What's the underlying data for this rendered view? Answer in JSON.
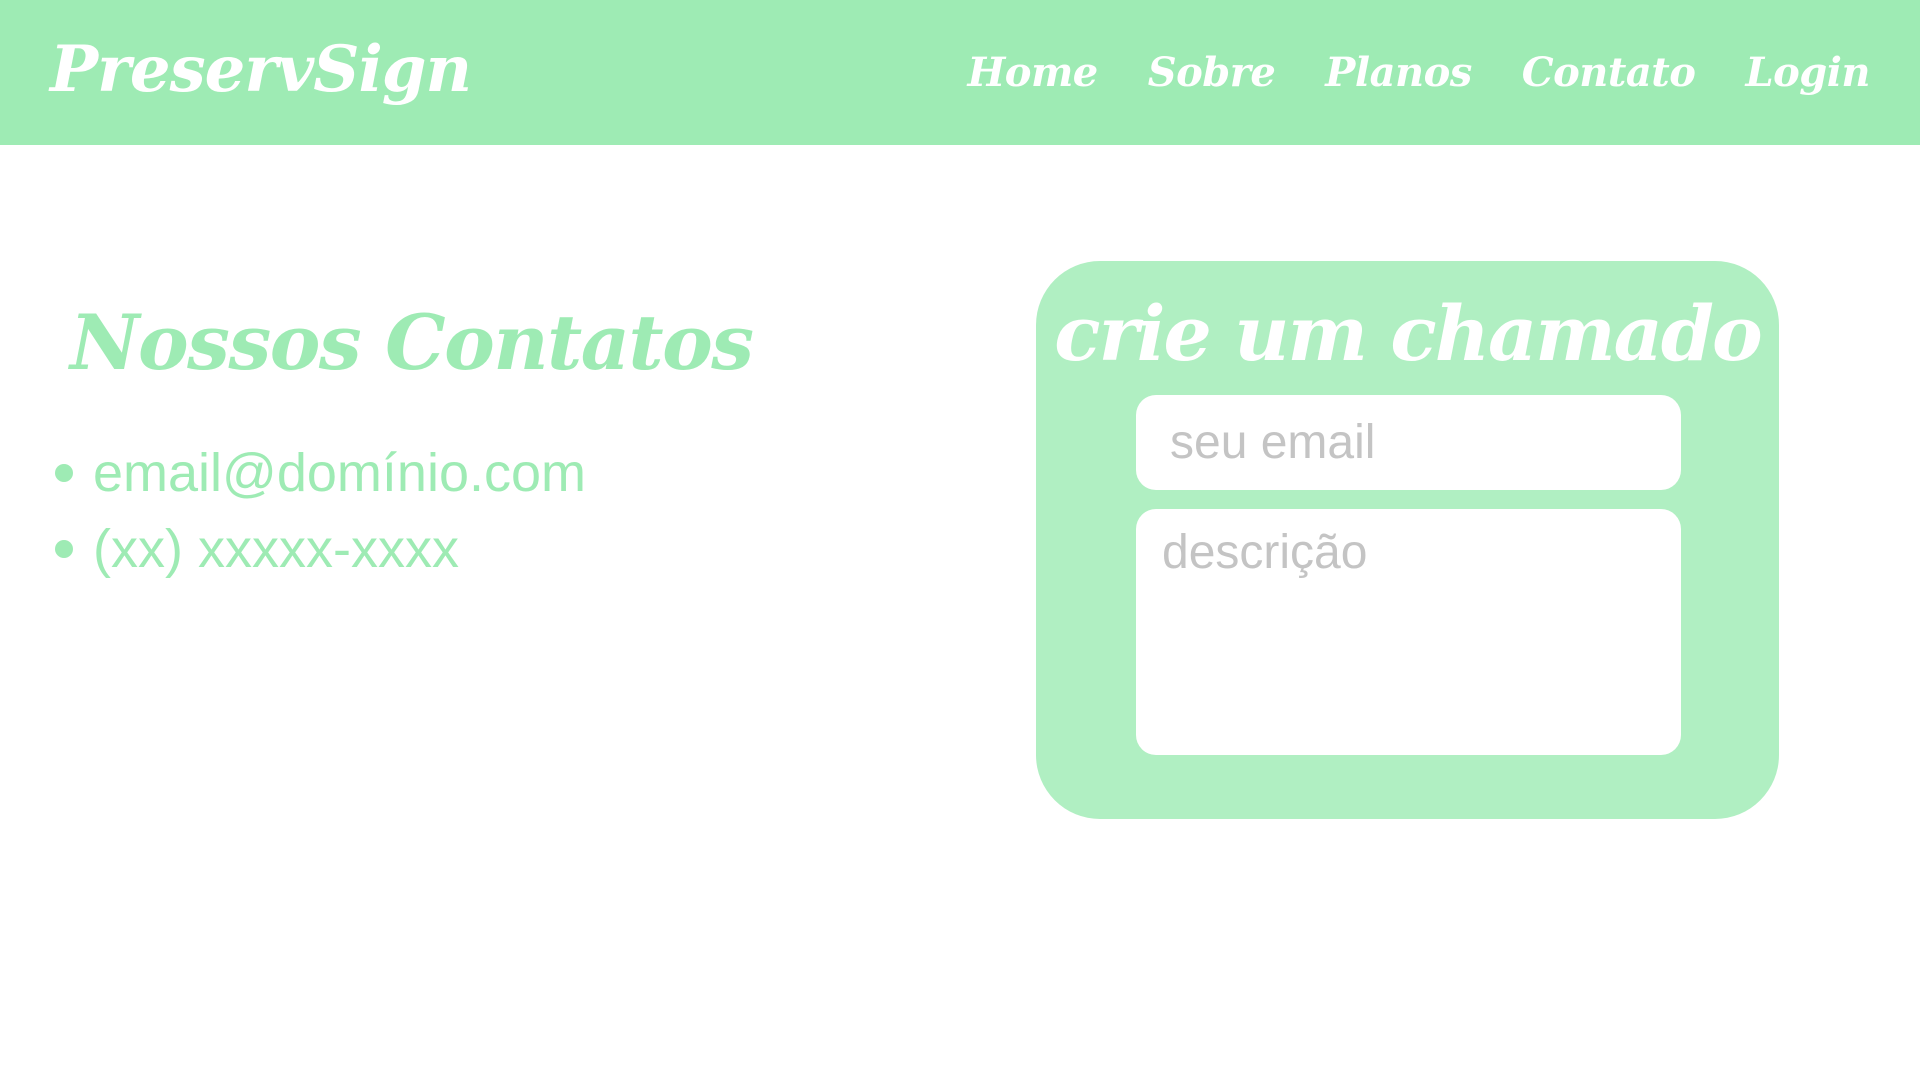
{
  "header": {
    "logo": "PreservSign",
    "nav": {
      "home": "Home",
      "sobre": "Sobre",
      "planos": "Planos",
      "contato": "Contato",
      "login": "Login"
    }
  },
  "contacts": {
    "title": "Nossos Contatos",
    "items": [
      "email@domínio.com",
      "(xx) xxxxx-xxxx"
    ]
  },
  "ticket": {
    "title": "crie um chamado",
    "email_placeholder": "seu email",
    "description_placeholder": "descrição"
  },
  "colors": {
    "header_bg": "#9eebb4",
    "card_bg": "#b0efc2",
    "accent_text": "#9eebb4",
    "placeholder": "#c4c4c4"
  }
}
